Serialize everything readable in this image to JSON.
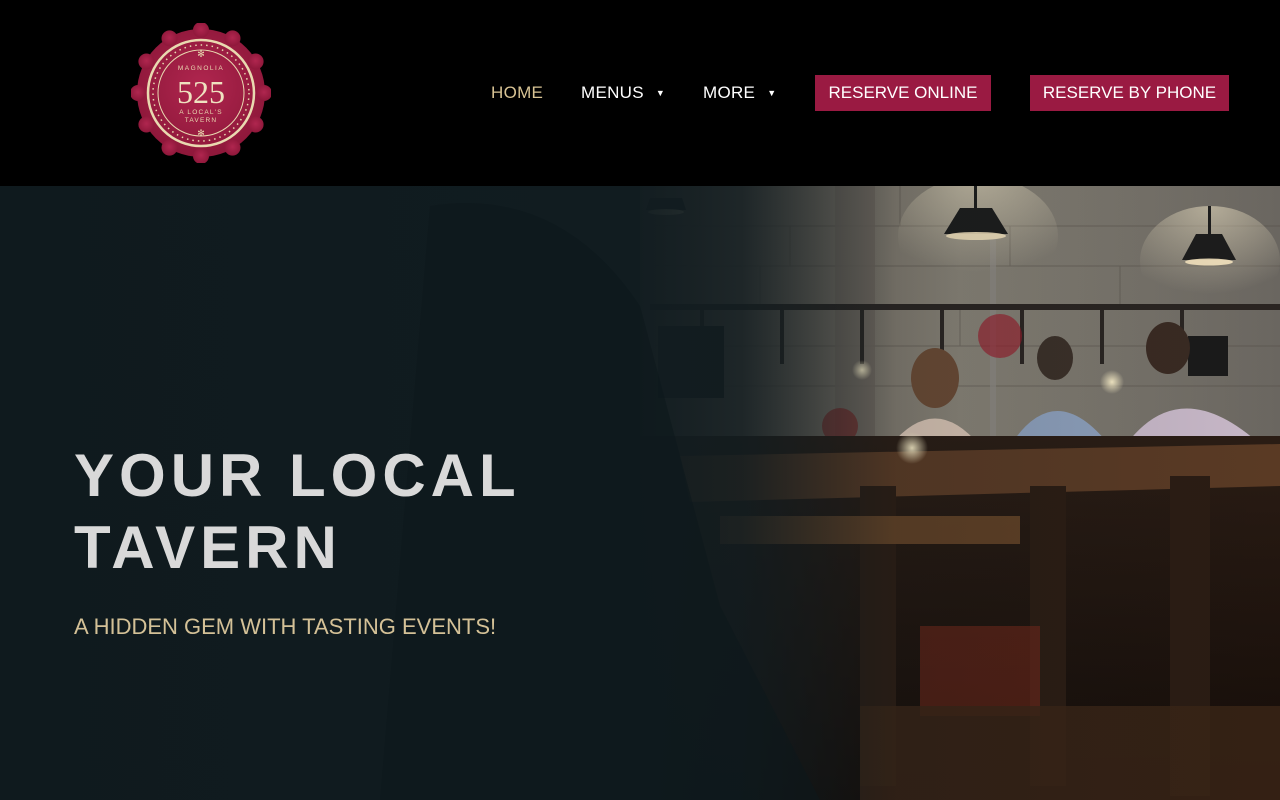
{
  "brand": {
    "logo_top": "MAGNOLIA",
    "logo_number": "525",
    "logo_line1": "A LOCAL'S",
    "logo_line2": "TAVERN",
    "color_primary": "#9a1a42",
    "color_gold": "#d8c394"
  },
  "nav": {
    "home": "HOME",
    "menus": "MENUS",
    "more": "MORE",
    "reserve_online": "RESERVE ONLINE",
    "reserve_phone": "RESERVE BY PHONE",
    "caret": "▼"
  },
  "hero": {
    "title": "YOUR LOCAL TAVERN",
    "subtitle": "A HIDDEN GEM WITH TASTING EVENTS!"
  }
}
